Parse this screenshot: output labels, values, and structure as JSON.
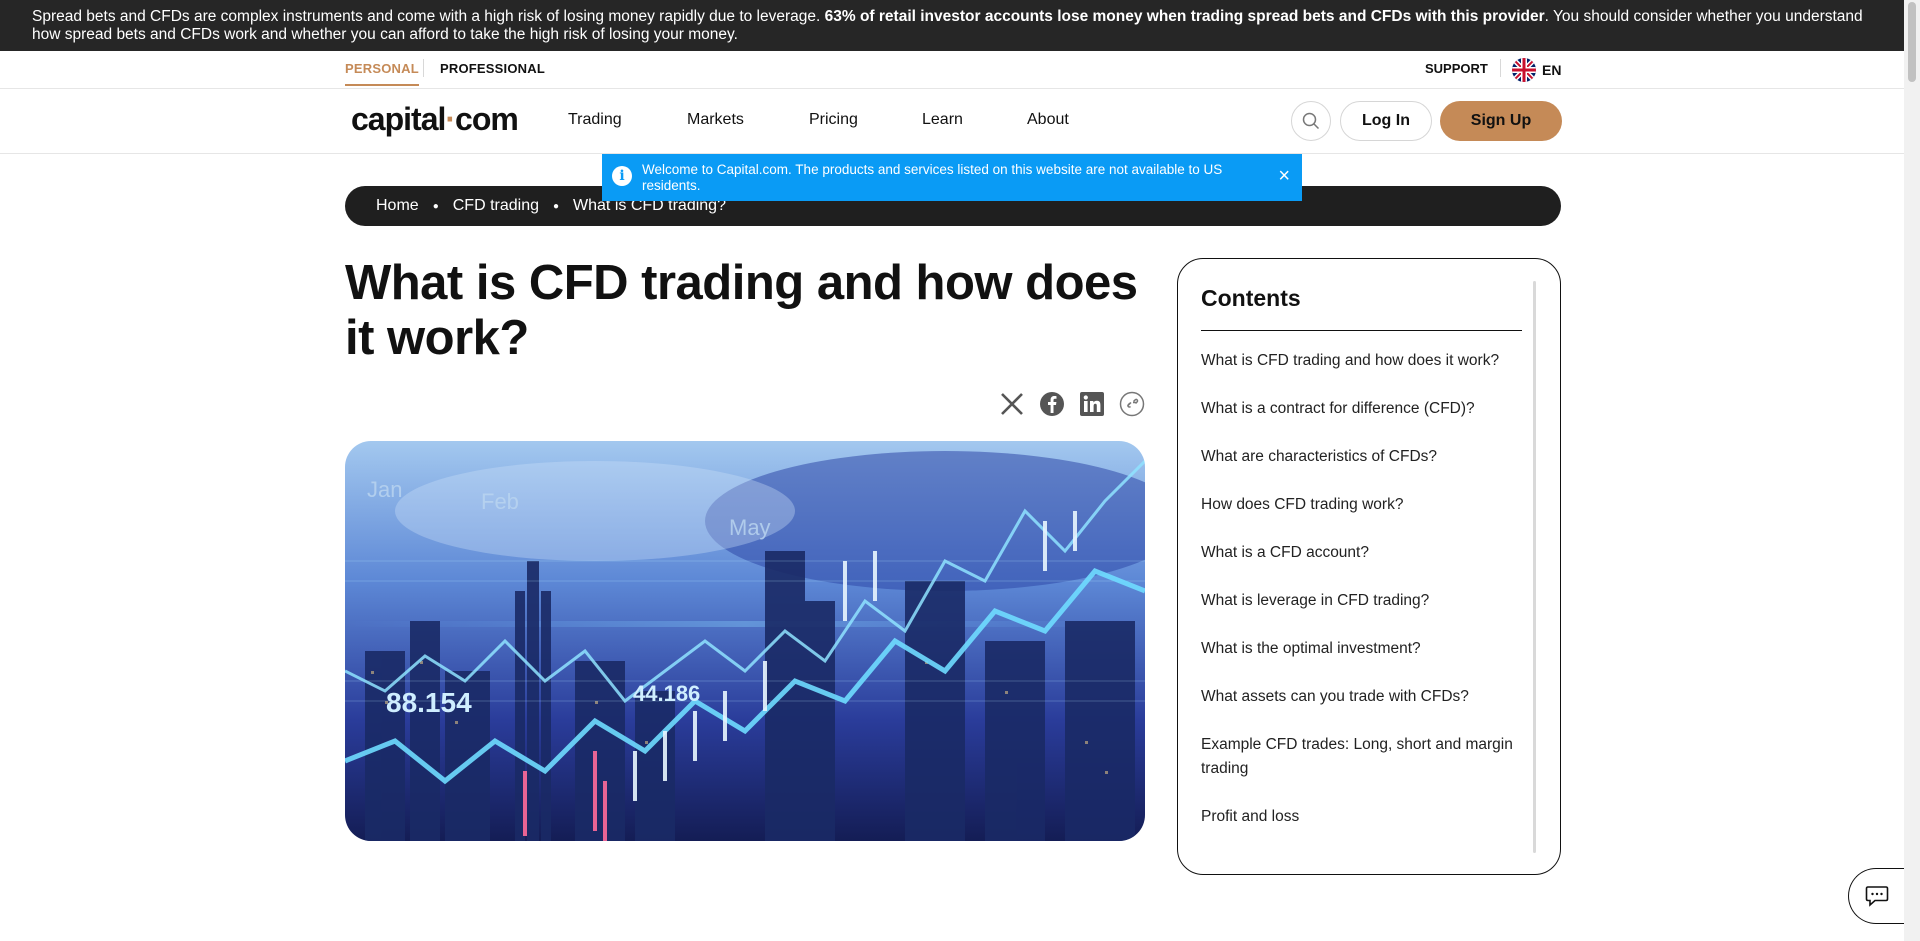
{
  "risk_banner": {
    "text_before": "Spread bets and CFDs are complex instruments and come with a high risk of losing money rapidly due to leverage. ",
    "text_bold": "63% of retail investor accounts lose money when trading spread bets and CFDs with this provider",
    "text_after": ". You should consider whether you understand how spread bets and CFDs work and whether you can afford to take the high risk of losing your money."
  },
  "top_bar": {
    "personal": "PERSONAL",
    "professional": "PROFESSIONAL",
    "support": "SUPPORT",
    "language": "EN"
  },
  "nav": {
    "logo_left": "capital",
    "logo_dot": "·",
    "logo_right": "com",
    "items": [
      "Trading",
      "Markets",
      "Pricing",
      "Learn",
      "About"
    ],
    "login": "Log In",
    "signup": "Sign Up"
  },
  "toast": {
    "text": "Welcome to Capital.com. The products and services listed on this website are not available to US residents.",
    "close": "×"
  },
  "breadcrumb": [
    "Home",
    "CFD trading",
    "What is CFD trading?"
  ],
  "article": {
    "title": "What is CFD trading and how does it work?",
    "hero_numbers": [
      "88.154",
      "44.186"
    ],
    "hero_months": [
      "Jan",
      "Feb",
      "May"
    ]
  },
  "share_icons": [
    "x-icon",
    "facebook-icon",
    "linkedin-icon",
    "copy-link-icon"
  ],
  "contents": {
    "heading": "Contents",
    "items": [
      "What is CFD trading and how does it work?",
      "What is a contract for difference (CFD)?",
      "What are characteristics of CFDs?",
      "How does CFD trading work?",
      "What is a CFD account?",
      "What is leverage in CFD trading?",
      "What is the optimal investment?",
      "What assets can you trade with CFDs?",
      "Example CFD trades: Long, short and margin trading",
      "Profit and loss"
    ]
  },
  "colors": {
    "accent": "#c58a57",
    "toast": "#0a9bf5",
    "dark": "#1f1f1f"
  }
}
